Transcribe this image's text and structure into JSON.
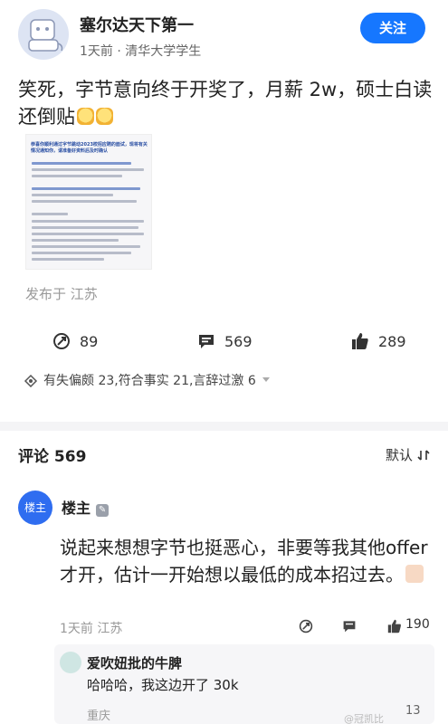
{
  "post": {
    "author": "塞尔达天下第一",
    "meta": "1天前 · 清华大学学生",
    "follow_label": "关注",
    "text": "笑死，字节意向终于开奖了，月薪 2w，硕士白读还倒贴",
    "doc_heading": "恭喜你顺利通过字节跳动2023校招应聘的面试，现将有关情况通知你，请准备好资料后及时确认",
    "published": "发布于 江苏",
    "actions": {
      "reposts": "89",
      "comments": "569",
      "likes": "289"
    },
    "reactions": "有失偏颇 23,符合事实 21,言辞过激 6",
    "icons": {
      "repost": "repost-icon",
      "comment": "comment-icon",
      "like": "thumbs-up-icon",
      "reaction": "reaction-icon"
    }
  },
  "comments": {
    "title": "评论 569",
    "sort_label": "默认",
    "top": {
      "avatar_label": "楼主",
      "name": "楼主",
      "text": "说起来想想字节也挺恶心，非要等我其他offer才开，估计一开始想以最低的成本招过去。",
      "meta": "1天前 江苏",
      "likes": "190"
    },
    "reply": {
      "name": "爱吹妞批的牛脾",
      "text": "哈哈哈，我这边开了 30k",
      "meta": "重庆",
      "count": "13",
      "watermark": "@冠凯比"
    }
  },
  "colors": {
    "accent": "#1677ff",
    "muted": "#999999"
  }
}
